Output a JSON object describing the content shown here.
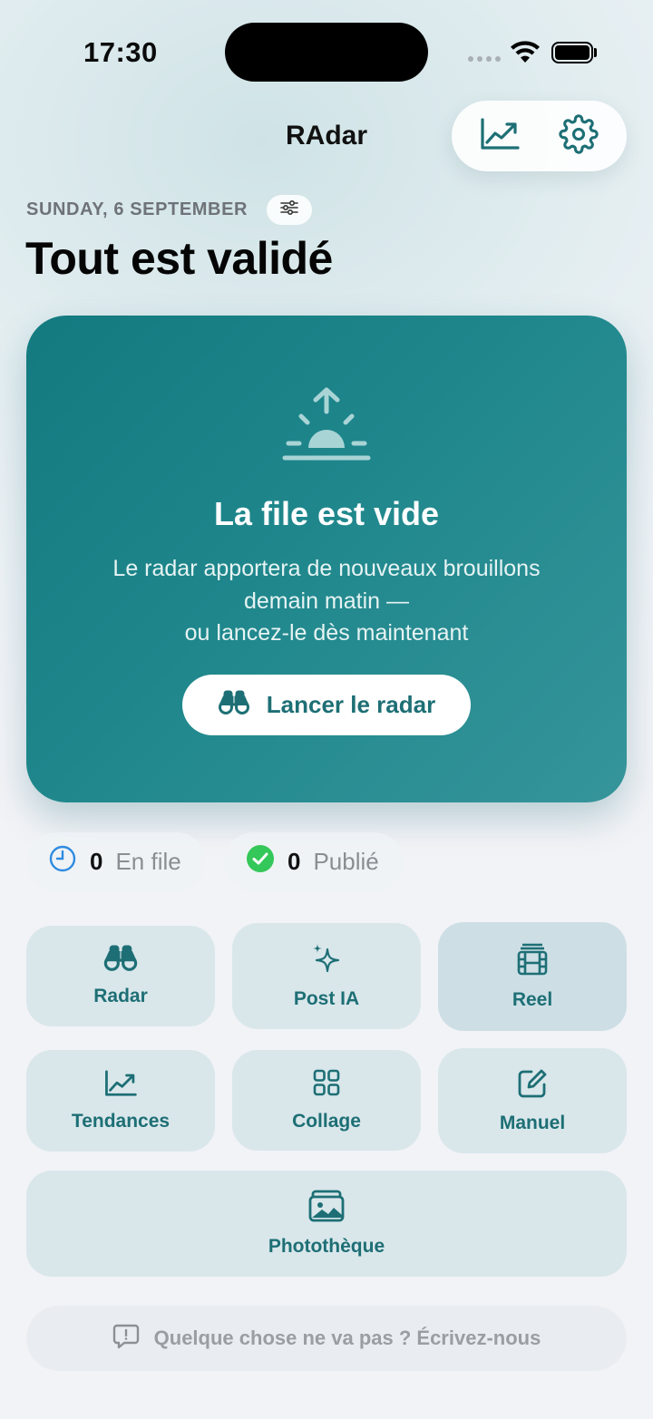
{
  "status_bar": {
    "time": "17:30"
  },
  "header": {
    "title": "RAdar"
  },
  "top_actions": {
    "stats_icon": "chart-trend-icon",
    "settings_icon": "gear-icon"
  },
  "date_label": "SUNDAY, 6 SEPTEMBER",
  "page_title": "Tout est validé",
  "empty_card": {
    "icon": "sunrise-icon",
    "title": "La file est vide",
    "line1": "Le radar apportera de nouveaux brouillons",
    "line2": "demain matin —",
    "line3": "ou lancez-le dès maintenant",
    "button_label": "Lancer le radar",
    "accent": "#1d6f75"
  },
  "stats": [
    {
      "value": "0",
      "label": "En file",
      "icon": "clock-icon"
    },
    {
      "value": "0",
      "label": "Publié",
      "icon": "check-circle-icon"
    }
  ],
  "tiles": [
    {
      "label": "Radar",
      "icon": "binoculars-icon"
    },
    {
      "label": "Post IA",
      "icon": "sparkles-icon"
    },
    {
      "label": "Reel",
      "icon": "film-icon"
    },
    {
      "label": "Tendances",
      "icon": "chart-trend-icon"
    },
    {
      "label": "Collage",
      "icon": "grid-icon"
    },
    {
      "label": "Manuel",
      "icon": "edit-icon"
    },
    {
      "label": "Photothèque",
      "icon": "photos-icon"
    }
  ],
  "feedback": {
    "label": "Quelque chose ne va pas ? Écrivez-nous",
    "icon": "message-alert-icon"
  }
}
